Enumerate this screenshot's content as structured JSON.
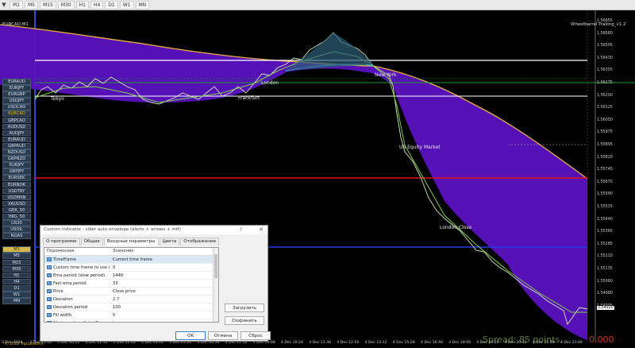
{
  "toolbar": {
    "timeframes": [
      "M1",
      "M5",
      "M15",
      "M30",
      "H1",
      "H4",
      "D1",
      "W1",
      "MN"
    ]
  },
  "chart": {
    "symbol_title": "EURCAD,M1",
    "indicator_name": "Wheelbarrel Trailing_v1.2",
    "symbols": [
      "EURAUD",
      "EURJPY",
      "EURGBP",
      "USDJPY",
      "USDCAD",
      "EURCAD",
      "GBPCAD",
      "AUDUSD",
      "AUDJPY",
      "EURAUD",
      "GBPAUD",
      "NZDUSD",
      "GBPNZD",
      "EURJPY",
      "GBPJPY",
      "EURSEK",
      "EURNOK",
      "USDTRY",
      "USDMXN",
      "XAUUSD",
      "GER_30",
      "HKG_50",
      "US30",
      "USOIL",
      "NGAS"
    ],
    "active_symbol": "EURCAD",
    "tf_buttons": [
      "M1",
      "M5",
      "M15",
      "M30",
      "H1",
      "H4",
      "D1",
      "W1",
      "MN"
    ],
    "active_tf": "M1",
    "price_labels": [
      "1.56655",
      "1.56580",
      "1.56505",
      "1.56430",
      "1.56355",
      "1.56275",
      "1.56200",
      "1.56125",
      "1.56050",
      "1.55975",
      "1.55895",
      "1.55820",
      "1.55745",
      "1.55670",
      "1.55590",
      "1.55515",
      "1.55440",
      "1.55365",
      "1.55285",
      "1.55210",
      "1.55135",
      "1.55060",
      "1.54980",
      "1.54905"
    ],
    "current_price": "1.54920",
    "time_labels": [
      "3 Dec 2020",
      "3 Dec 23:00",
      "4 Dec 00:16",
      "4 Dec 01:32",
      "4 Dec 02:48",
      "4 Dec 04:04",
      "4 Dec 05:20",
      "4 Dec 06:36",
      "4 Dec 07:52",
      "4 Dec 09:08",
      "4 Dec 10:24",
      "4 Dec 11:40",
      "4 Dec 12:56",
      "4 Dec 14:12",
      "4 Dec 15:28",
      "4 Dec 16:44",
      "4 Dec 18:00",
      "4 Dec 19:16",
      "4 Dec 20:32",
      "4 Dec 21:48",
      "4 Dec 23:04"
    ],
    "sessions": {
      "tokyo": "Tokyo",
      "frankfurt": "Frankfurt",
      "london": "London",
      "new_york": "New York",
      "us_equity": "US Equity Market",
      "london_close": "London Close"
    },
    "spread_text": "Spread: 85 points.",
    "spread_value": "0.000",
    "copyright": "© 2018 TopLessons"
  },
  "dialog": {
    "title": "Custom Indicator - slder auto envelope (alerts + arrows + mtf)",
    "help": "?",
    "close": "✕",
    "tabs": [
      "О программе",
      "Общие",
      "Входные параметры",
      "Цвета",
      "Отображение"
    ],
    "active_tab": "Входные параметры",
    "col_variable": "Переменная",
    "col_value": "Значение",
    "params": [
      {
        "name": "TimeFrame",
        "value": "Current time frame"
      },
      {
        "name": "Custom time frame to use (if custo...",
        "value": "0"
      },
      {
        "name": "Ema period (slow period)",
        "value": "1440"
      },
      {
        "name": "Fast ema period",
        "value": "33"
      },
      {
        "name": "Price",
        "value": "Close price"
      },
      {
        "name": "Deviation",
        "value": "2.7"
      },
      {
        "name": "Deviation period",
        "value": "100"
      },
      {
        "name": "Fill width",
        "value": "5"
      },
      {
        "name": "Alerts on (true/false)?",
        "value": "true"
      }
    ],
    "load_btn": "Загрузить",
    "save_btn": "Сохранить",
    "ok_btn": "OK",
    "cancel_btn": "Отмена",
    "reset_btn": "Сброс"
  }
}
